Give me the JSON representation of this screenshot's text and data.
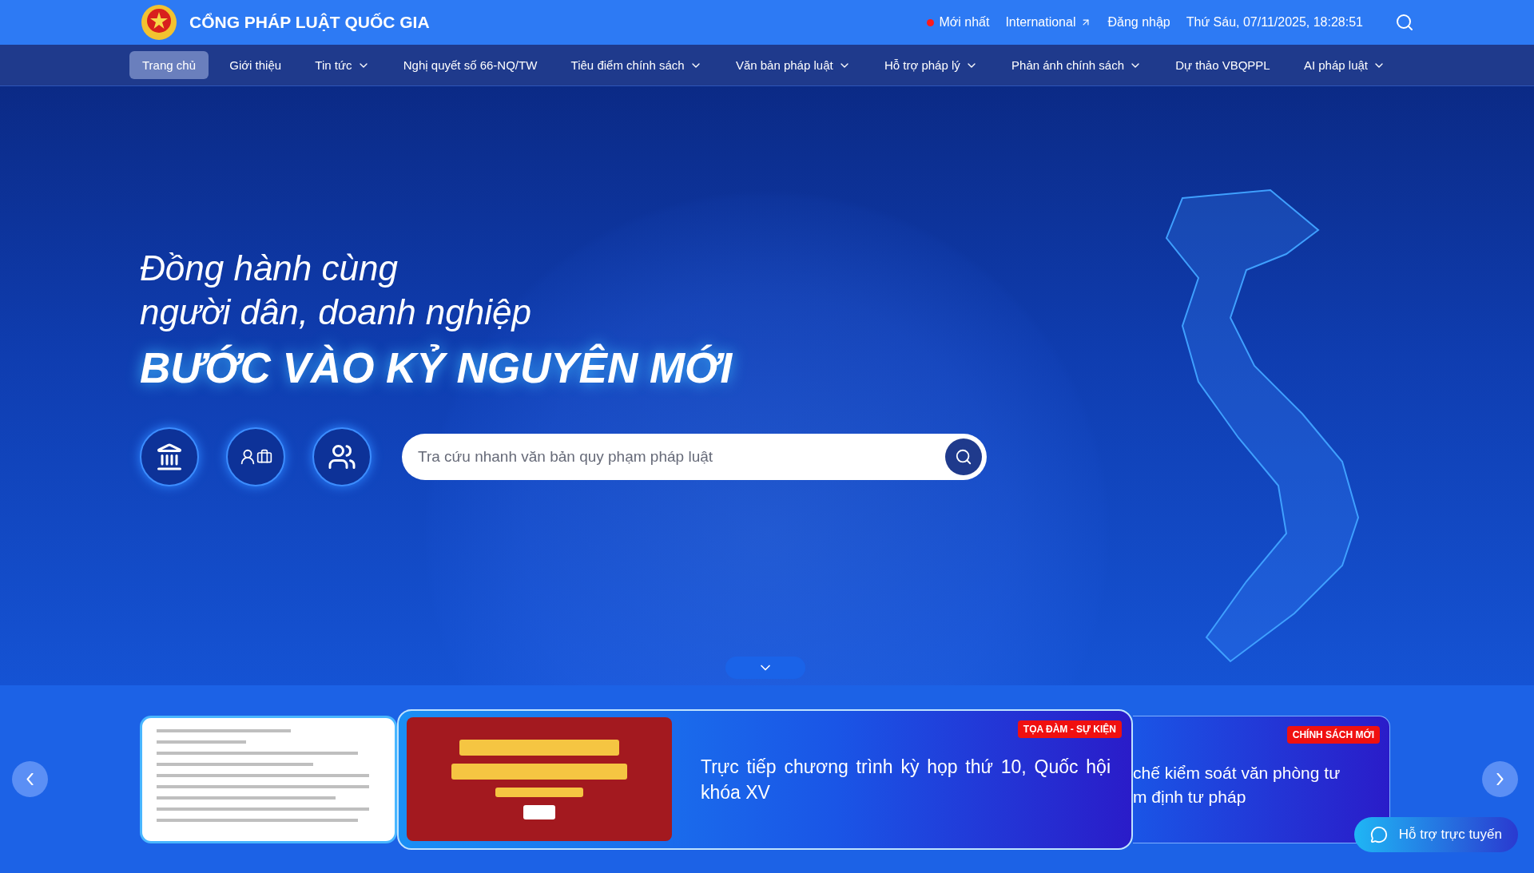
{
  "header": {
    "title": "CỔNG PHÁP LUẬT QUỐC GIA",
    "links": [
      {
        "label": "Mới nhất",
        "kind": "dot"
      },
      {
        "label": "International",
        "kind": "external"
      },
      {
        "label": "Đăng nhập",
        "kind": "plain"
      }
    ],
    "datetime": "Thứ Sáu, 07/11/2025, 18:28:51"
  },
  "nav": [
    {
      "label": "Trang chủ",
      "selected": true,
      "dropdown": false
    },
    {
      "label": "Giới thiệu",
      "selected": false,
      "dropdown": false
    },
    {
      "label": "Tin tức",
      "selected": false,
      "dropdown": true
    },
    {
      "label": "Nghị quyết số 66-NQ/TW",
      "selected": false,
      "dropdown": false
    },
    {
      "label": "Tiêu điểm chính sách",
      "selected": false,
      "dropdown": true
    },
    {
      "label": "Văn bản pháp luật",
      "selected": false,
      "dropdown": true
    },
    {
      "label": "Hỗ trợ pháp lý",
      "selected": false,
      "dropdown": true
    },
    {
      "label": "Phản ánh chính sách",
      "selected": false,
      "dropdown": true
    },
    {
      "label": "Dự thảo VBQPPL",
      "selected": false,
      "dropdown": false
    },
    {
      "label": "AI pháp luật",
      "selected": false,
      "dropdown": true
    }
  ],
  "hero": {
    "lines": [
      "Đồng hành cùng",
      "người dân, doanh nghiệp"
    ],
    "headline": "BƯỚC VÀO KỶ NGUYÊN MỚI",
    "search": {
      "placeholder": "Tra cứu nhanh văn bản quy phạm pháp luật"
    }
  },
  "carousel": {
    "cards": [
      {
        "kind": "document"
      },
      {
        "kind": "featured",
        "tag": "TỌA ĐÀM - SỰ KIỆN",
        "title": "Trực tiếp chương trình kỳ họp thứ 10, Quốc hội khóa XV"
      },
      {
        "kind": "partial",
        "tag": "CHÍNH SÁCH MỚI",
        "lines": [
          "chế kiểm soát văn phòng tư",
          "m định tư pháp"
        ]
      }
    ]
  },
  "chat": {
    "label": "Hỗ trợ trực tuyến"
  }
}
